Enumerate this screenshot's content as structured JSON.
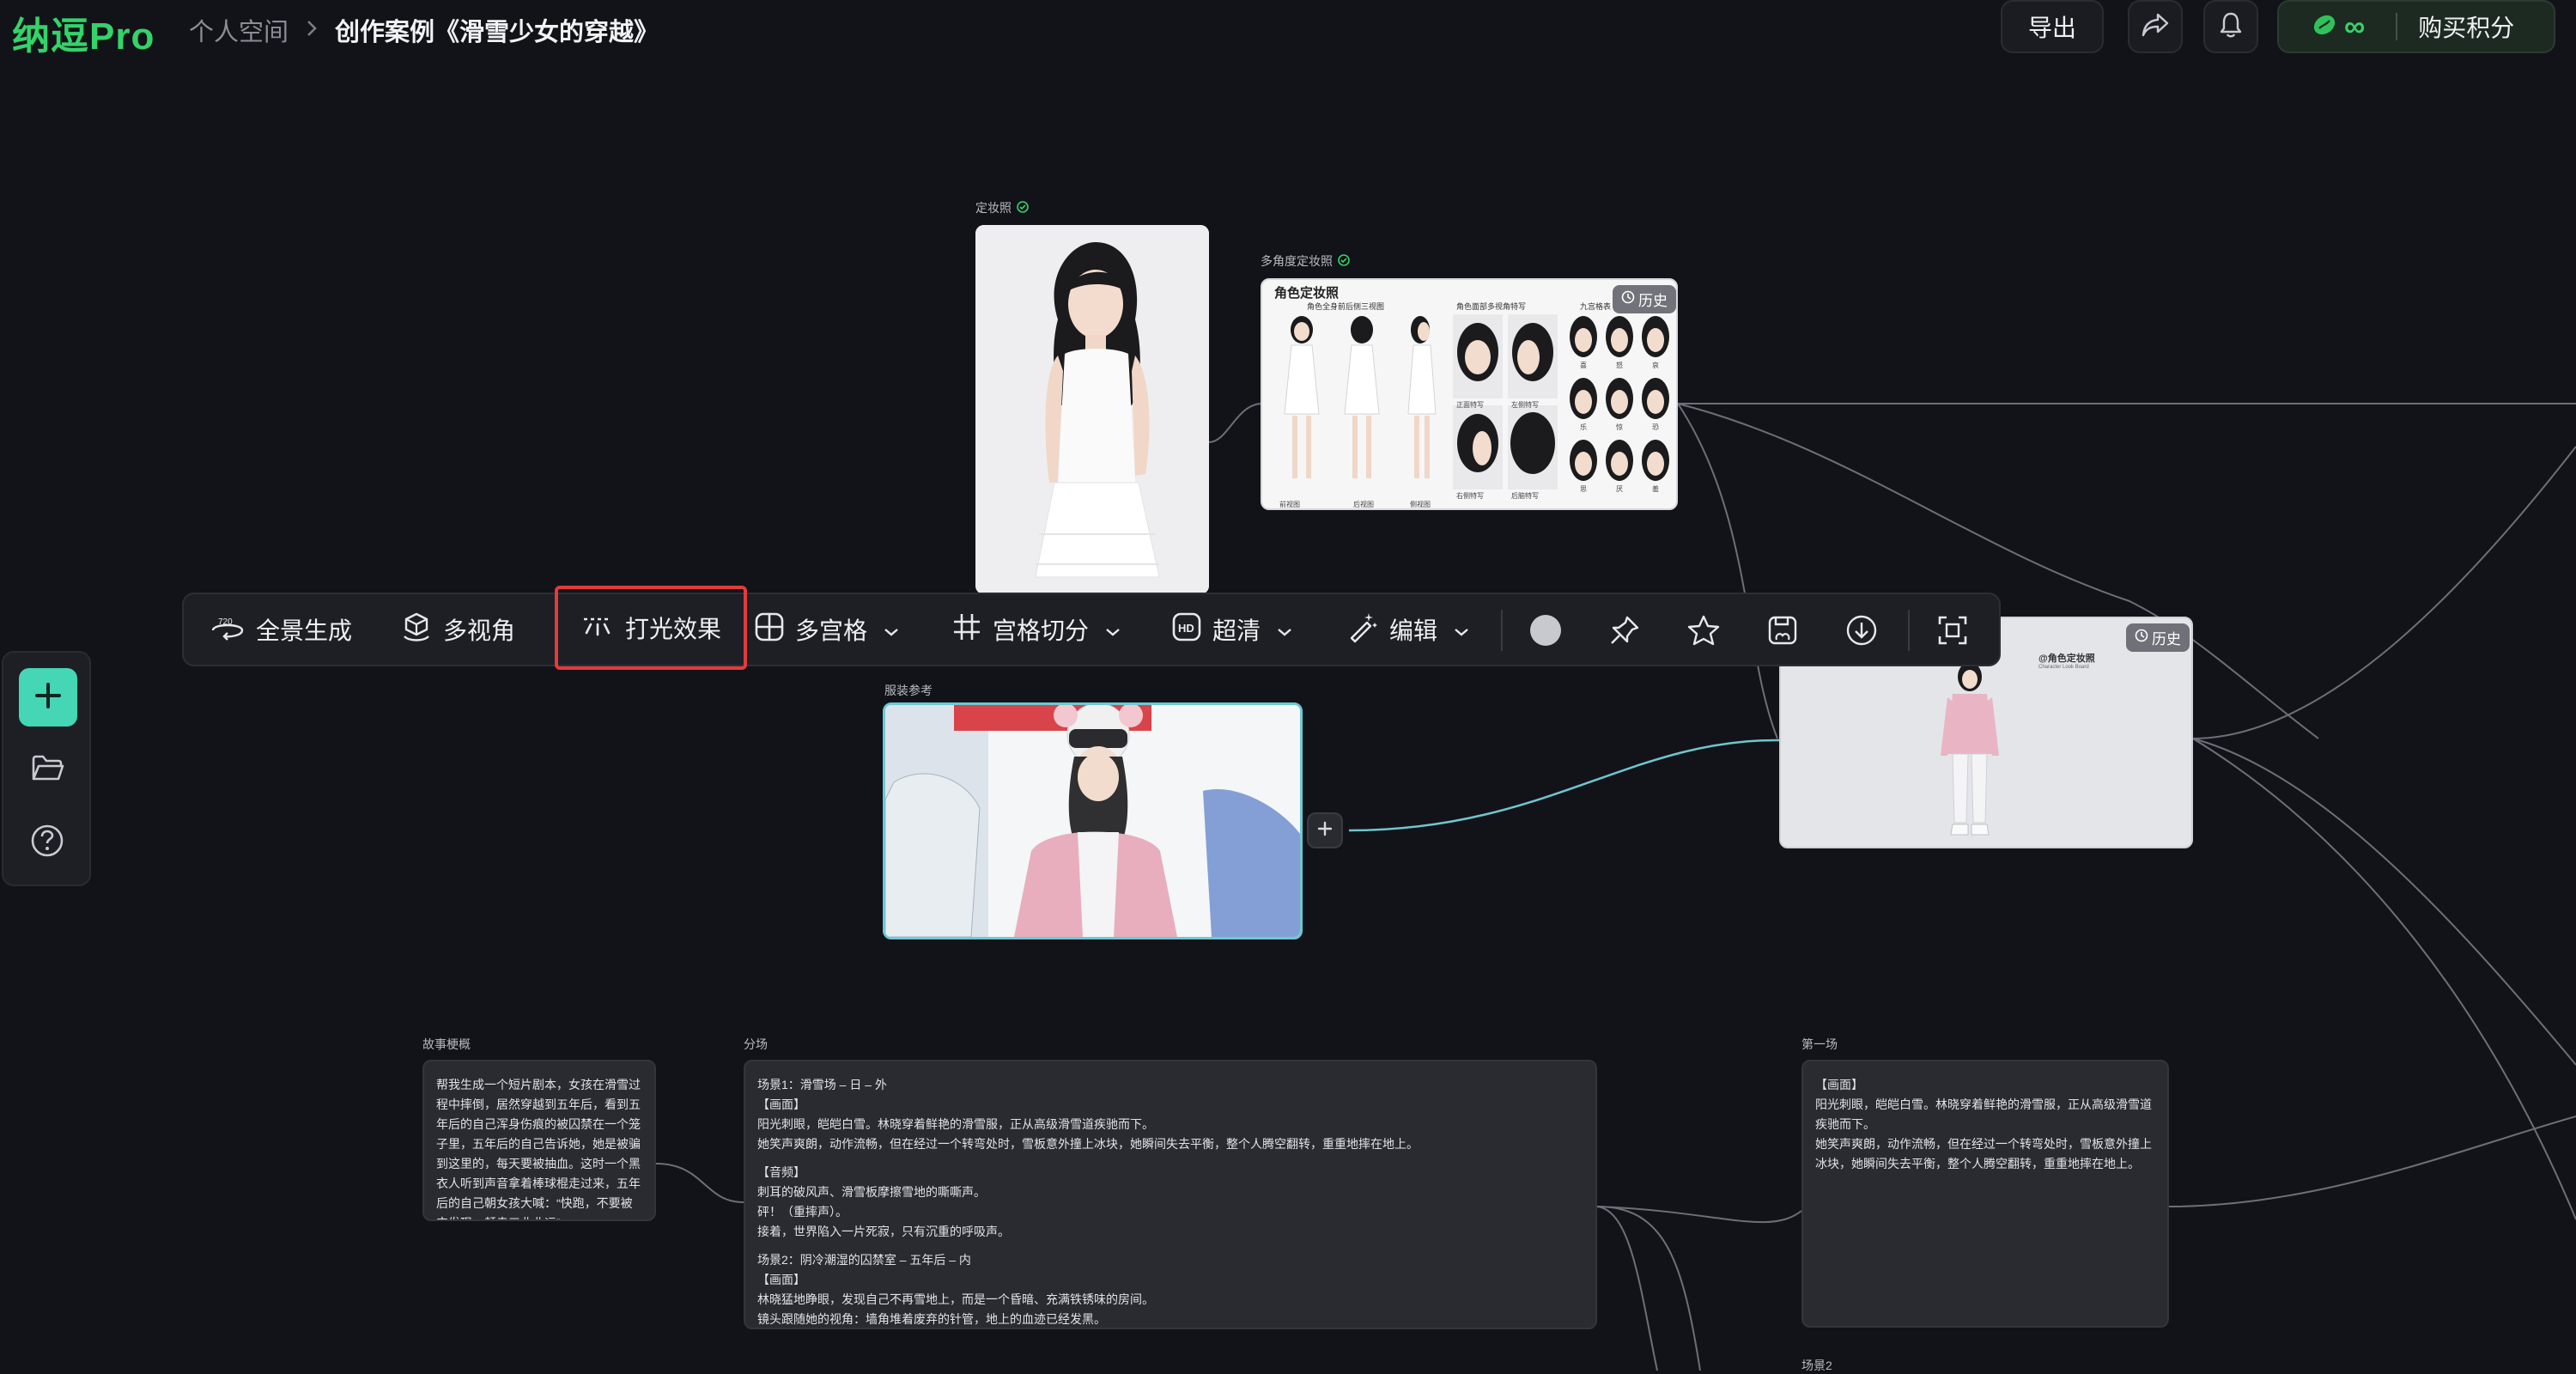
{
  "header": {
    "logo": "纳逗Pro",
    "breadcrumb": [
      "个人空间",
      "创作案例《滑雪少女的穿越》"
    ],
    "export_label": "导出",
    "credits_symbol": "∞",
    "buy_label": "购买积分"
  },
  "nodes": {
    "makeup_photo": {
      "label": "定妆照",
      "verified": true
    },
    "multi_angle": {
      "label": "多角度定妆照",
      "verified": true,
      "history": "历史",
      "sheet_title": "角色定妆照",
      "section_titles": [
        "角色全身前后侧三视图",
        "角色面部多视角特写",
        "九宫格表"
      ],
      "full_body_captions": [
        "前视图",
        "后视图",
        "侧视图"
      ],
      "face_captions": [
        "正面特写",
        "左侧特写",
        "右侧特写",
        "后脑特写"
      ],
      "grid_captions": [
        "喜",
        "怒",
        "哀",
        "乐",
        "惊",
        "恐",
        "思",
        "厌",
        "羞"
      ]
    },
    "outfit_result": {
      "history": "历史",
      "sheet_title": "@角色定妆照",
      "sheet_sub": "Character Look Board"
    },
    "outfit_ref": {
      "label": "服装参考"
    },
    "story": {
      "label": "故事梗概",
      "text": "帮我生成一个短片剧本，女孩在滑雪过程中摔倒，居然穿越到五年后，看到五年后的自己浑身伤痕的被囚禁在一个笼子里，五年后的自己告诉她，她是被骗到这里的，每天要被抽血。这时一个黑衣人听到声音拿着棒球棍走过来，五年后的自己朝女孩大喊：“快跑，不要被它发现，赶走三曲曲运”"
    },
    "scenes": {
      "label": "分场",
      "lines": [
        "场景1：滑雪场 – 日 – 外",
        "【画面】",
        "阳光刺眼，皑皑白雪。林晓穿着鲜艳的滑雪服，正从高级滑雪道疾驰而下。",
        "她笑声爽朗，动作流畅，但在经过一个转弯处时，雪板意外撞上冰块，她瞬间失去平衡，整个人腾空翻转，重重地摔在地上。",
        "",
        "【音频】",
        "刺耳的破风声、滑雪板摩擦雪地的嘶嘶声。",
        "砰！（重摔声）。",
        "接着，世界陷入一片死寂，只有沉重的呼吸声。",
        "",
        "场景2：阴冷潮湿的囚禁室 – 五年后 – 内",
        "【画面】",
        "林晓猛地睁眼，发现自己不再雪地上，而是一个昏暗、充满铁锈味的房间。",
        "镜头跟随她的视角：墙角堆着废弃的针管，地上的血迹已经发黑。"
      ]
    },
    "scene1": {
      "label": "第一场",
      "lines": [
        "【画面】",
        "阳光刺眼，皑皑白雪。林晓穿着鲜艳的滑雪服，正从高级滑雪道疾驰而下。",
        "她笑声爽朗，动作流畅，但在经过一个转弯处时，雪板意外撞上冰块，她瞬间失去平衡，整个人腾空翻转，重重地摔在地上。"
      ]
    },
    "scene2": {
      "label": "场景2"
    }
  },
  "toolbar": {
    "panorama": "全景生成",
    "multi_view": "多视角",
    "lighting": "打光效果",
    "multi_grid": "多宫格",
    "grid_split": "宫格切分",
    "hd": "超清",
    "edit": "编辑"
  },
  "icons": {
    "panorama": "panorama-720-icon",
    "multi_view": "cube-hand-icon",
    "lighting": "lighting-icon",
    "multi_grid": "grid-icon",
    "grid_split": "hash-icon",
    "hd": "hd-icon",
    "edit": "magic-wand-icon",
    "actions": [
      "color-circle-icon",
      "pin-icon",
      "star-icon",
      "save-icon",
      "download-icon",
      "focus-frame-icon"
    ],
    "dock": [
      "plus-icon",
      "folder-icon",
      "help-icon"
    ]
  },
  "colors": {
    "background": "#121318",
    "brand_green": "#34d36a",
    "accent_teal": "#45d6b5",
    "highlight_red": "#e23b3b"
  }
}
